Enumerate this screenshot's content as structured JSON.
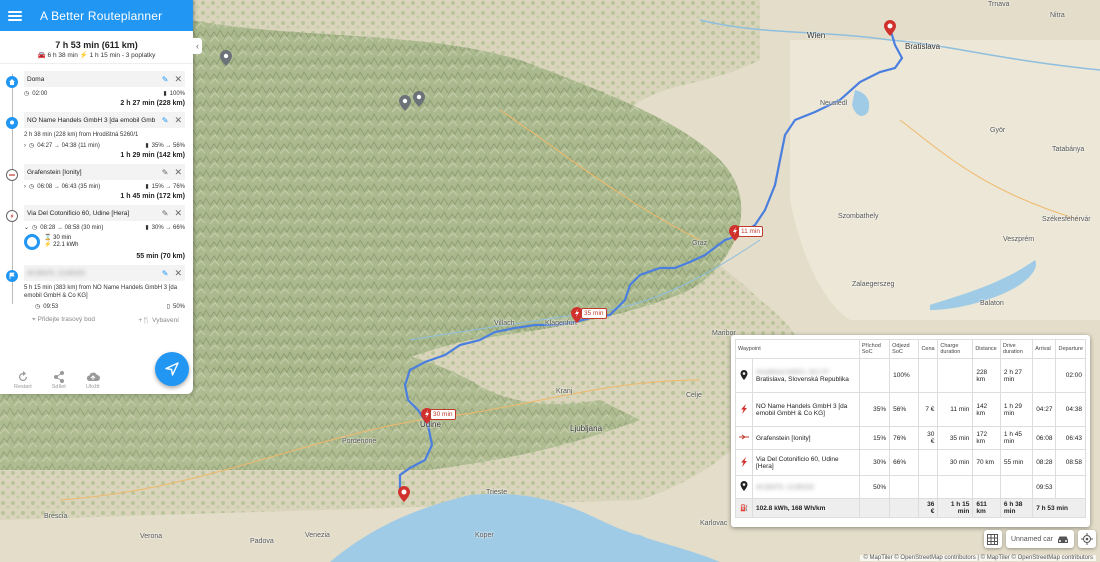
{
  "app": {
    "title": "A Better Routeplanner"
  },
  "summary": {
    "total": "7 h 53 min (611 km)",
    "sub_drive": "6 h 38 min",
    "sub_charge": "1 h 15 min - 3 poplatky"
  },
  "stops": [
    {
      "name": "Doma",
      "time": "02:00",
      "soc": "100%",
      "leg": "2 h 27 min (228 km)"
    },
    {
      "name": "NO Name Handels GmbH 3 [da emobil GmbH",
      "desc": "2 h 38 min (228 km) from Hrodištná 5260/1",
      "time": "04:27 → 04:38 (11 min)",
      "soc": "35% → 56%",
      "leg": "1 h 29 min (142 km)"
    },
    {
      "name": "Grafenstein [Ionity]",
      "time": "06:08 → 06:43 (35 min)",
      "soc": "15% → 76%",
      "leg": "1 h 45 min (172 km)"
    },
    {
      "name": "Via Del Cotonificio 60, Udine [Hera]",
      "time": "08:28 → 08:58 (30 min)",
      "soc": "30% → 66%",
      "charge_time": "30 min",
      "charge_energy": "22.1 kWh",
      "leg": "55 min (70 km)"
    },
    {
      "name": "40,65475, 13,85233",
      "desc": "5 h 15 min (383 km) from NO Name Handels GmbH 3 [da emobil GmbH & Co KG]",
      "time": "09:53",
      "soc": "50%"
    }
  ],
  "add": {
    "waypoint": "Přidejte trasový bod",
    "amenities": "Vybavení"
  },
  "actions": {
    "reset": "Restart",
    "share": "Sdílet",
    "save": "Uložit"
  },
  "map": {
    "places": [
      "Wien",
      "Trnava",
      "Nitra",
      "Bratislava",
      "Györ",
      "Tatabánya",
      "Székesfehérvár",
      "Veszprém",
      "Szombathely",
      "Zalaegerszeg",
      "Graz",
      "Villach",
      "Klagenfurt",
      "Udine",
      "Pordenone",
      "Ljubljana",
      "Kranj",
      "Celje",
      "Maribor",
      "Trieste",
      "Koper",
      "Padova",
      "Verona",
      "Brescia",
      "Venezia",
      "Karlovac",
      "Neusiedl",
      "Balaton"
    ],
    "charge_labels": [
      "11 min",
      "35 min",
      "30 min"
    ],
    "attribution": "© MapTiler © OpenStreetMap contributors | © MapTiler © OpenStreetMap contributors"
  },
  "table": {
    "headers": [
      "Waypoint",
      "Příchod SoC",
      "Odjezd SoC",
      "Cena",
      "Charge duration",
      "Distance",
      "Drive duration",
      "Arrival",
      "Departure"
    ],
    "rows": [
      {
        "icon": "pin",
        "waypoint_blur": "Hrodištná 5260/1, 821 07",
        "waypoint": "Bratislava, Slovenská Republika",
        "arr_soc": "",
        "dep_soc": "100%",
        "cost": "",
        "charge": "",
        "dist": "228 km",
        "drive": "2 h 27 min",
        "arrival": "",
        "departure": "02:00"
      },
      {
        "icon": "bolt",
        "waypoint_blur": "",
        "waypoint": "NO Name Handels GmbH 3 [da emobil GmbH & Co KG]",
        "arr_soc": "35%",
        "dep_soc": "56%",
        "cost": "7 €",
        "charge": "11 min",
        "dist": "142 km",
        "drive": "1 h 29 min",
        "arrival": "04:27",
        "departure": "04:38"
      },
      {
        "icon": "ionity",
        "waypoint_blur": "",
        "waypoint": "Grafenstein [Ionity]",
        "arr_soc": "15%",
        "dep_soc": "76%",
        "cost": "30 €",
        "charge": "35 min",
        "dist": "172 km",
        "drive": "1 h 45 min",
        "arrival": "06:08",
        "departure": "06:43"
      },
      {
        "icon": "bolt",
        "waypoint_blur": "",
        "waypoint": "Via Del Cotonificio 60, Udine [Hera]",
        "arr_soc": "30%",
        "dep_soc": "66%",
        "cost": "",
        "charge": "30 min",
        "dist": "70 km",
        "drive": "55 min",
        "arrival": "08:28",
        "departure": "08:58"
      },
      {
        "icon": "pin",
        "waypoint_blur": "40,65475, 13,85233",
        "waypoint": "",
        "arr_soc": "50%",
        "dep_soc": "",
        "cost": "",
        "charge": "",
        "dist": "",
        "drive": "",
        "arrival": "09:53",
        "departure": ""
      }
    ],
    "sum": {
      "label": "102.8 kWh, 168 Wh/km",
      "cost": "36 €",
      "charge": "1 h 15 min",
      "dist": "611 km",
      "drive": "6 h 38 min",
      "total": "7 h 53 min"
    }
  },
  "car": {
    "label": "Unnamed car"
  },
  "colors": {
    "accent": "#2196f3",
    "route": "#4a7fe0",
    "charger": "#d0312d"
  }
}
